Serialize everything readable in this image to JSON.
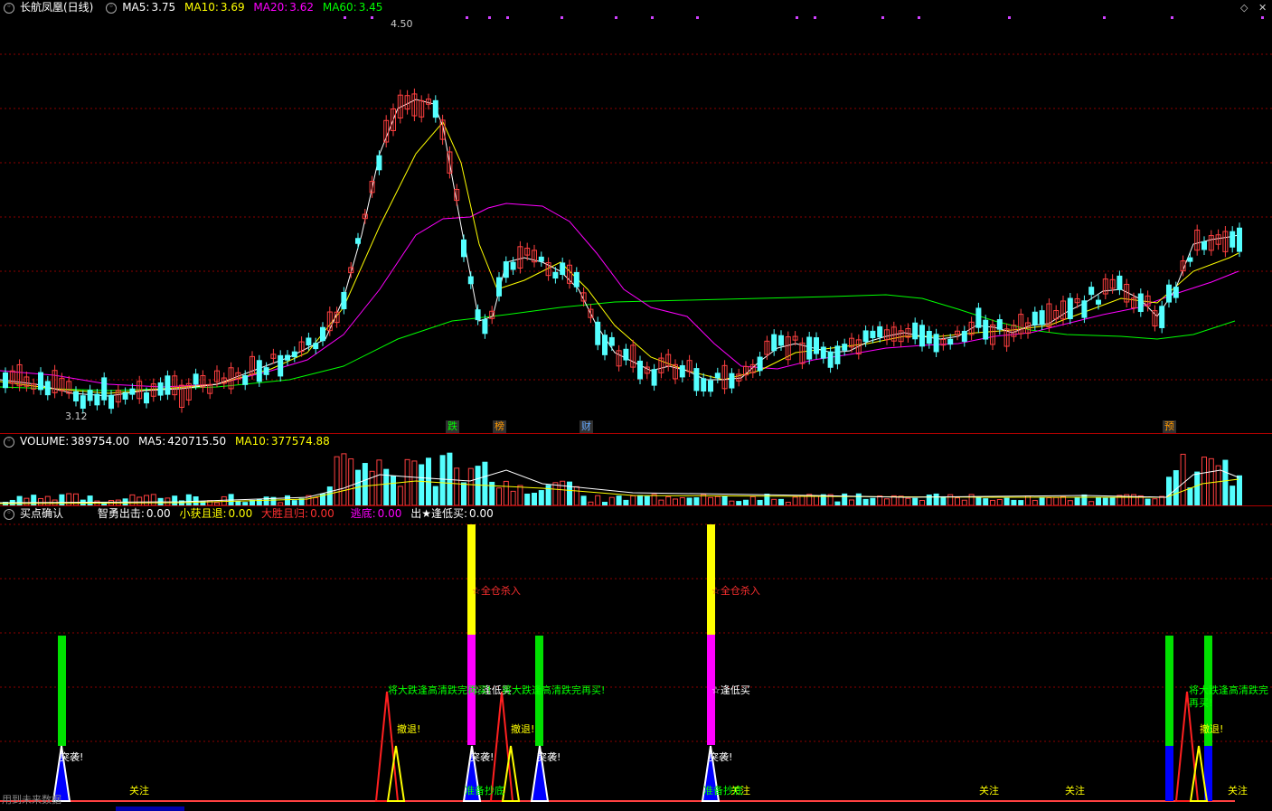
{
  "main": {
    "title": "长航凤凰(日线)",
    "ma5_label": "MA5:",
    "ma5": "3.75",
    "ma10_label": "MA10:",
    "ma10": "3.69",
    "ma20_label": "MA20:",
    "ma20": "3.62",
    "ma60_label": "MA60:",
    "ma60": "3.45",
    "high_label": "4.50",
    "low_label": "3.12",
    "tags": [
      "跌",
      "榜",
      "财",
      "预"
    ]
  },
  "volume": {
    "title": "VOLUME:",
    "value": "389754.00",
    "ma5_label": "MA5:",
    "ma5": "420715.50",
    "ma10_label": "MA10:",
    "ma10": "377574.88"
  },
  "indicator": {
    "title": "买点确认",
    "zy_label": "智勇出击:",
    "zy": "0.00",
    "xh_label": "小获且退:",
    "xh": "0.00",
    "ds_label": "大胜且归:",
    "ds": "0.00",
    "td_label": "逃底:",
    "td": "0.00",
    "cx_label": "出★逢低买:",
    "cx": "0.00",
    "t_quanc": "☆全仓杀入",
    "t_dimai": "☆逢低买",
    "t_jiang": "将大跌逢高清跌完再买!",
    "t_chetui": "撤退!",
    "t_tuxi": "突袭!",
    "t_guanzhu": "关注",
    "t_zhunbei": "准备抄底",
    "footer": "用到未来数据"
  },
  "colors": {
    "up": "#ff4040",
    "down": "#54ffff",
    "ma5": "#ffffff",
    "ma10": "#ffff00",
    "ma20": "#ff00ff",
    "ma60": "#00ff00",
    "grid": "#8b0000"
  }
}
